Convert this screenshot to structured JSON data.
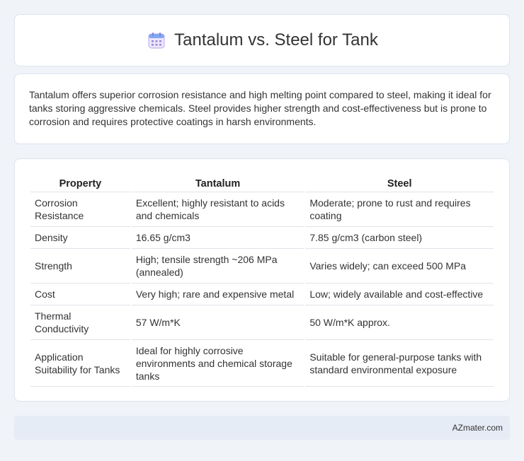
{
  "header": {
    "title": "Tantalum vs. Steel for Tank",
    "icon": "calendar-icon"
  },
  "summary": {
    "text": "Tantalum offers superior corrosion resistance and high melting point compared to steel, making it ideal for tanks storing aggressive chemicals. Steel provides higher strength and cost-effectiveness but is prone to corrosion and requires protective coatings in harsh environments."
  },
  "table": {
    "headers": [
      "Property",
      "Tantalum",
      "Steel"
    ],
    "rows": [
      [
        "Corrosion Resistance",
        "Excellent; highly resistant to acids and chemicals",
        "Moderate; prone to rust and requires coating"
      ],
      [
        "Density",
        "16.65 g/cm3",
        "7.85 g/cm3 (carbon steel)"
      ],
      [
        "Strength",
        "High; tensile strength ~206 MPa (annealed)",
        "Varies widely; can exceed 500 MPa"
      ],
      [
        "Cost",
        "Very high; rare and expensive metal",
        "Low; widely available and cost-effective"
      ],
      [
        "Thermal Conductivity",
        "57 W/m*K",
        "50 W/m*K approx."
      ],
      [
        "Application Suitability for Tanks",
        "Ideal for highly corrosive environments and chemical storage tanks",
        "Suitable for general-purpose tanks with standard environmental exposure"
      ]
    ]
  },
  "footer": {
    "brand": "AZmater.com"
  }
}
